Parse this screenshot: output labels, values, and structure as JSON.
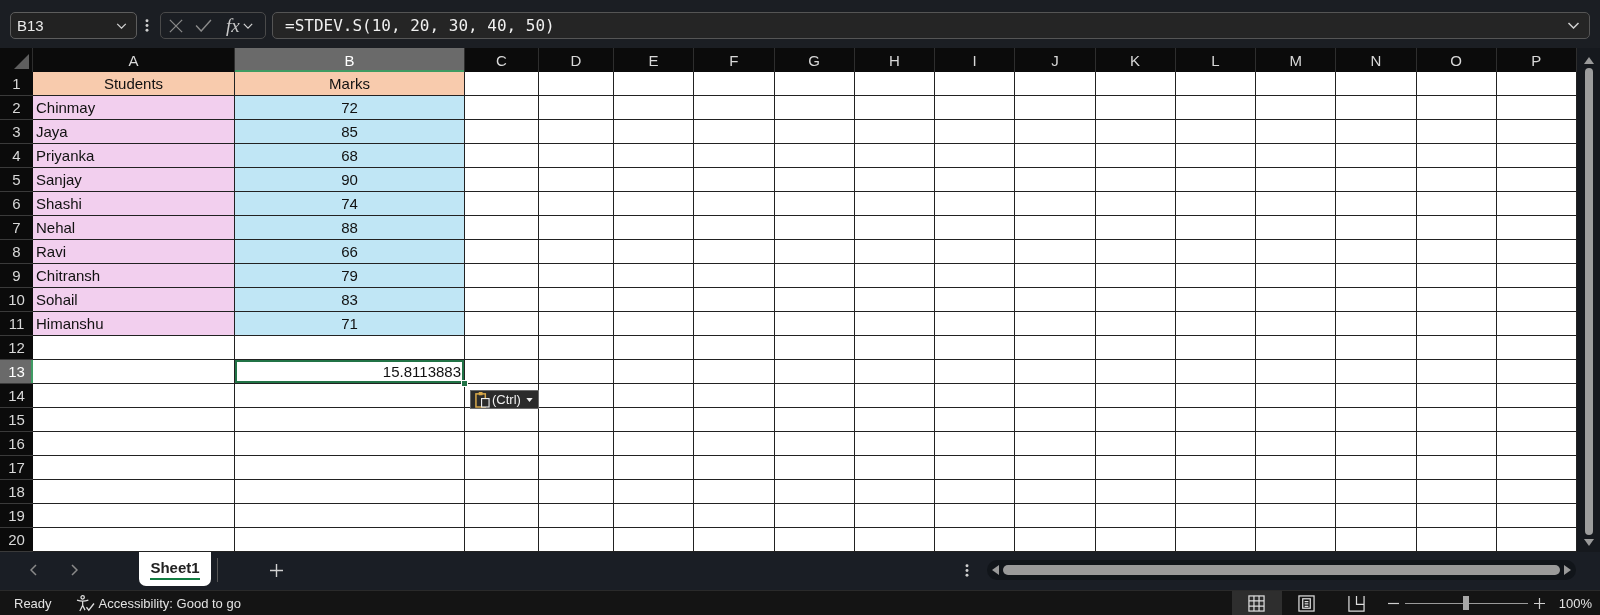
{
  "formula_bar": {
    "name_box": "B13",
    "function_label": "fx",
    "formula": "=STDEV.S(10, 20, 30, 40, 50)"
  },
  "columns": [
    {
      "label": "A",
      "selected": false
    },
    {
      "label": "B",
      "selected": true
    },
    {
      "label": "C",
      "selected": false
    },
    {
      "label": "D",
      "selected": false
    },
    {
      "label": "E",
      "selected": false
    },
    {
      "label": "F",
      "selected": false
    },
    {
      "label": "G",
      "selected": false
    },
    {
      "label": "H",
      "selected": false
    },
    {
      "label": "I",
      "selected": false
    },
    {
      "label": "J",
      "selected": false
    },
    {
      "label": "K",
      "selected": false
    },
    {
      "label": "L",
      "selected": false
    },
    {
      "label": "M",
      "selected": false
    },
    {
      "label": "N",
      "selected": false
    },
    {
      "label": "O",
      "selected": false
    },
    {
      "label": "P",
      "selected": false
    }
  ],
  "rows": [
    {
      "label": "1",
      "selected": false,
      "cells": [
        {
          "text": "Students",
          "color": "#f8cbad",
          "kind": "center",
          "selected": false
        },
        {
          "text": "Marks",
          "color": "#f8cbad",
          "kind": "center",
          "selected": false
        }
      ]
    },
    {
      "label": "2",
      "selected": false,
      "cells": [
        {
          "text": "Chinmay",
          "color": "#f2cfee",
          "kind": "left",
          "selected": false
        },
        {
          "text": "72",
          "color": "#c0e6f5",
          "kind": "center",
          "selected": false
        }
      ]
    },
    {
      "label": "3",
      "selected": false,
      "cells": [
        {
          "text": "Jaya",
          "color": "#f2cfee",
          "kind": "left",
          "selected": false
        },
        {
          "text": "85",
          "color": "#c0e6f5",
          "kind": "center",
          "selected": false
        }
      ]
    },
    {
      "label": "4",
      "selected": false,
      "cells": [
        {
          "text": "Priyanka",
          "color": "#f2cfee",
          "kind": "left",
          "selected": false
        },
        {
          "text": "68",
          "color": "#c0e6f5",
          "kind": "center",
          "selected": false
        }
      ]
    },
    {
      "label": "5",
      "selected": false,
      "cells": [
        {
          "text": "Sanjay",
          "color": "#f2cfee",
          "kind": "left",
          "selected": false
        },
        {
          "text": "90",
          "color": "#c0e6f5",
          "kind": "center",
          "selected": false
        }
      ]
    },
    {
      "label": "6",
      "selected": false,
      "cells": [
        {
          "text": "Shashi",
          "color": "#f2cfee",
          "kind": "left",
          "selected": false
        },
        {
          "text": "74",
          "color": "#c0e6f5",
          "kind": "center",
          "selected": false
        }
      ]
    },
    {
      "label": "7",
      "selected": false,
      "cells": [
        {
          "text": "Nehal",
          "color": "#f2cfee",
          "kind": "left",
          "selected": false
        },
        {
          "text": "88",
          "color": "#c0e6f5",
          "kind": "center",
          "selected": false
        }
      ]
    },
    {
      "label": "8",
      "selected": false,
      "cells": [
        {
          "text": "Ravi",
          "color": "#f2cfee",
          "kind": "left",
          "selected": false
        },
        {
          "text": "66",
          "color": "#c0e6f5",
          "kind": "center",
          "selected": false
        }
      ]
    },
    {
      "label": "9",
      "selected": false,
      "cells": [
        {
          "text": "Chitransh",
          "color": "#f2cfee",
          "kind": "left",
          "selected": false
        },
        {
          "text": "79",
          "color": "#c0e6f5",
          "kind": "center",
          "selected": false
        }
      ]
    },
    {
      "label": "10",
      "selected": false,
      "cells": [
        {
          "text": "Sohail",
          "color": "#f2cfee",
          "kind": "left",
          "selected": false
        },
        {
          "text": "83",
          "color": "#c0e6f5",
          "kind": "center",
          "selected": false
        }
      ]
    },
    {
      "label": "11",
      "selected": false,
      "cells": [
        {
          "text": "Himanshu",
          "color": "#f2cfee",
          "kind": "left",
          "selected": false
        },
        {
          "text": "71",
          "color": "#c0e6f5",
          "kind": "center",
          "selected": false
        }
      ]
    },
    {
      "label": "12",
      "selected": false
    },
    {
      "label": "13",
      "selected": true,
      "cells": [
        {
          "selected": false
        },
        {
          "text": "15.8113883",
          "kind": "right",
          "selected": true
        }
      ]
    },
    {
      "label": "14",
      "selected": false
    },
    {
      "label": "15",
      "selected": false
    },
    {
      "label": "16",
      "selected": false
    },
    {
      "label": "17",
      "selected": false
    },
    {
      "label": "18",
      "selected": false
    },
    {
      "label": "19",
      "selected": false
    },
    {
      "label": "20",
      "selected": false
    }
  ],
  "paste_options": {
    "label": "(Ctrl)"
  },
  "sheet_tabs": [
    {
      "label": "Sheet1",
      "selected": true
    }
  ],
  "status_bar": {
    "status": "Ready",
    "accessibility": "Accessibility: Good to go",
    "views": [
      {
        "kind": "normal",
        "selected": true
      },
      {
        "kind": "page_layout",
        "selected": false
      },
      {
        "kind": "page_break_preview",
        "selected": false
      }
    ],
    "zoom": {
      "level": 0.5,
      "label": "100%"
    }
  }
}
